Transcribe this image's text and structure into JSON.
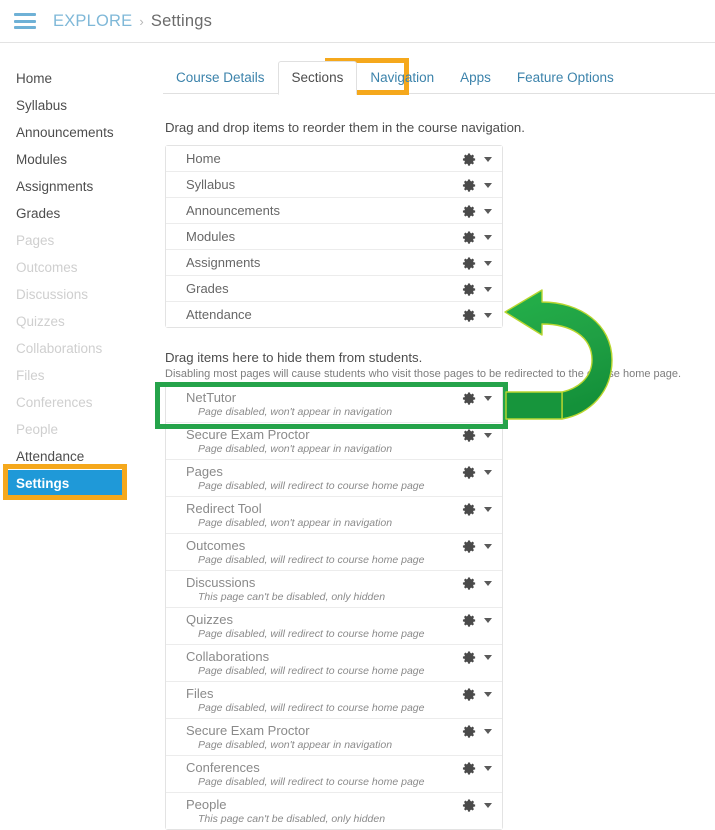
{
  "header": {
    "menu_icon": "hamburger-menu-icon",
    "breadcrumb_root": "EXPLORE",
    "breadcrumb_separator": "›",
    "breadcrumb_current": "Settings"
  },
  "sidebar": {
    "items": [
      {
        "label": "Home",
        "state": "normal"
      },
      {
        "label": "Syllabus",
        "state": "normal"
      },
      {
        "label": "Announcements",
        "state": "normal"
      },
      {
        "label": "Modules",
        "state": "normal"
      },
      {
        "label": "Assignments",
        "state": "normal"
      },
      {
        "label": "Grades",
        "state": "normal"
      },
      {
        "label": "Pages",
        "state": "dim"
      },
      {
        "label": "Outcomes",
        "state": "dim"
      },
      {
        "label": "Discussions",
        "state": "dim"
      },
      {
        "label": "Quizzes",
        "state": "dim"
      },
      {
        "label": "Collaborations",
        "state": "dim"
      },
      {
        "label": "Files",
        "state": "dim"
      },
      {
        "label": "Conferences",
        "state": "dim"
      },
      {
        "label": "People",
        "state": "dim"
      },
      {
        "label": "Attendance",
        "state": "normal"
      },
      {
        "label": "Settings",
        "state": "active"
      }
    ]
  },
  "tabs": [
    {
      "label": "Course Details",
      "active": false
    },
    {
      "label": "Sections",
      "active": true
    },
    {
      "label": "Navigation",
      "active": false
    },
    {
      "label": "Apps",
      "active": false
    },
    {
      "label": "Feature Options",
      "active": false
    }
  ],
  "main": {
    "reorder_instruction": "Drag and drop items to reorder them in the course navigation.",
    "hide_heading": "Drag items here to hide them from students.",
    "hide_note": "Disabling most pages will cause students who visit those pages to be redirected to the course home page.",
    "visible_items": [
      {
        "label": "Home"
      },
      {
        "label": "Syllabus"
      },
      {
        "label": "Announcements"
      },
      {
        "label": "Modules"
      },
      {
        "label": "Assignments"
      },
      {
        "label": "Grades"
      },
      {
        "label": "Attendance"
      }
    ],
    "hidden_items": [
      {
        "label": "NetTutor",
        "note": "Page disabled, won't appear in navigation"
      },
      {
        "label": "Secure Exam Proctor",
        "note": "Page disabled, won't appear in navigation"
      },
      {
        "label": "Pages",
        "note": "Page disabled, will redirect to course home page"
      },
      {
        "label": "Redirect Tool",
        "note": "Page disabled, won't appear in navigation"
      },
      {
        "label": "Outcomes",
        "note": "Page disabled, will redirect to course home page"
      },
      {
        "label": "Discussions",
        "note": "This page can't be disabled, only hidden"
      },
      {
        "label": "Quizzes",
        "note": "Page disabled, will redirect to course home page"
      },
      {
        "label": "Collaborations",
        "note": "Page disabled, will redirect to course home page"
      },
      {
        "label": "Files",
        "note": "Page disabled, will redirect to course home page"
      },
      {
        "label": "Secure Exam Proctor",
        "note": "Page disabled, won't appear in navigation"
      },
      {
        "label": "Conferences",
        "note": "Page disabled, will redirect to course home page"
      },
      {
        "label": "People",
        "note": "This page can't be disabled, only hidden"
      }
    ],
    "row_icons": {
      "gear": "gear-icon",
      "caret": "chevron-down-icon"
    }
  },
  "annotations": {
    "orange_color": "#f5a81c",
    "green_color": "#25a34a",
    "active_blue": "#1f99d8",
    "nav_tab_box": "Navigation",
    "settings_box": "Settings",
    "nettutor_box": "NetTutor",
    "arrow": "curved-arrow-left"
  }
}
